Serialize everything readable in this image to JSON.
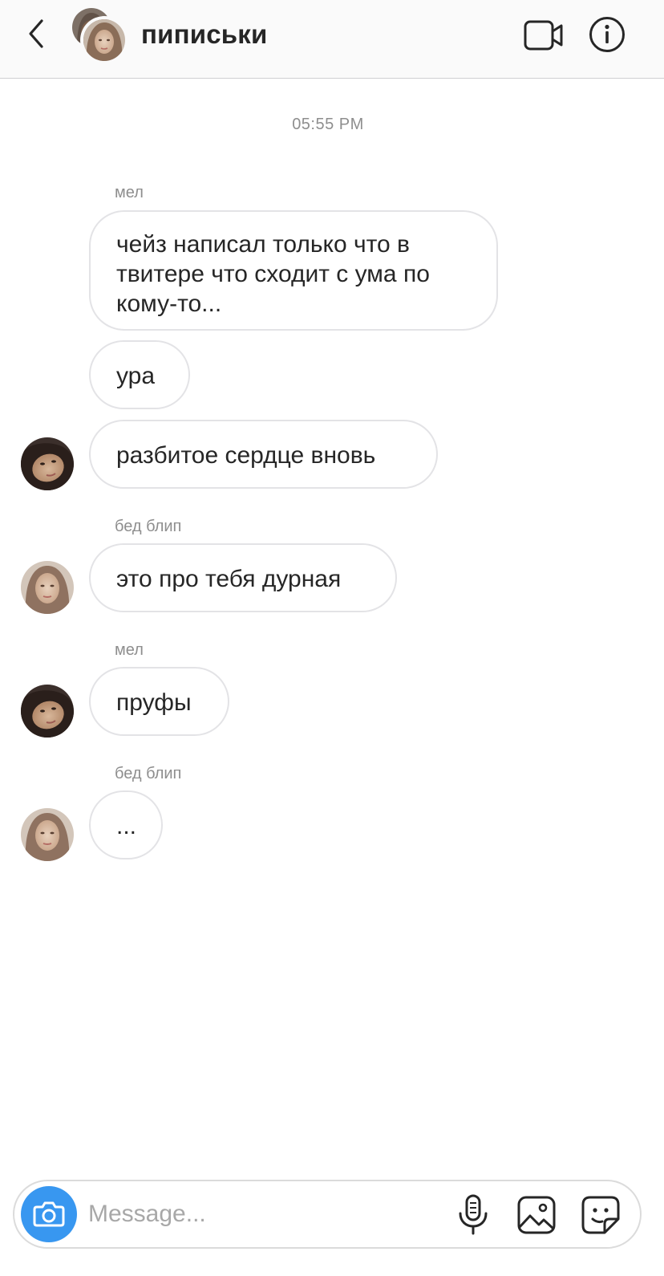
{
  "header": {
    "title": "пиписьки",
    "back_icon": "chevron-left-icon",
    "video_icon": "video-camera-icon",
    "info_icon": "info-icon"
  },
  "timestamp": "05:55 PM",
  "senders": {
    "mel": "мел",
    "bad_blip": "бед блип"
  },
  "messages": [
    {
      "text": "чейз написал только что в твитере что сходит с ума по кому-то..."
    },
    {
      "text": "ура"
    },
    {
      "text": "разбитое сердце вновь"
    },
    {
      "text": "это про тебя дурная"
    },
    {
      "text": "пруфы"
    },
    {
      "text": "..."
    }
  ],
  "composer": {
    "placeholder": "Message...",
    "camera_icon": "camera-icon",
    "mic_icon": "microphone-icon",
    "gallery_icon": "image-gallery-icon",
    "sticker_icon": "sticker-icon"
  },
  "colors": {
    "accent": "#3897f0",
    "bubble_border": "#e3e3e6",
    "meta_text": "#8e8e8e",
    "text": "#262626"
  }
}
